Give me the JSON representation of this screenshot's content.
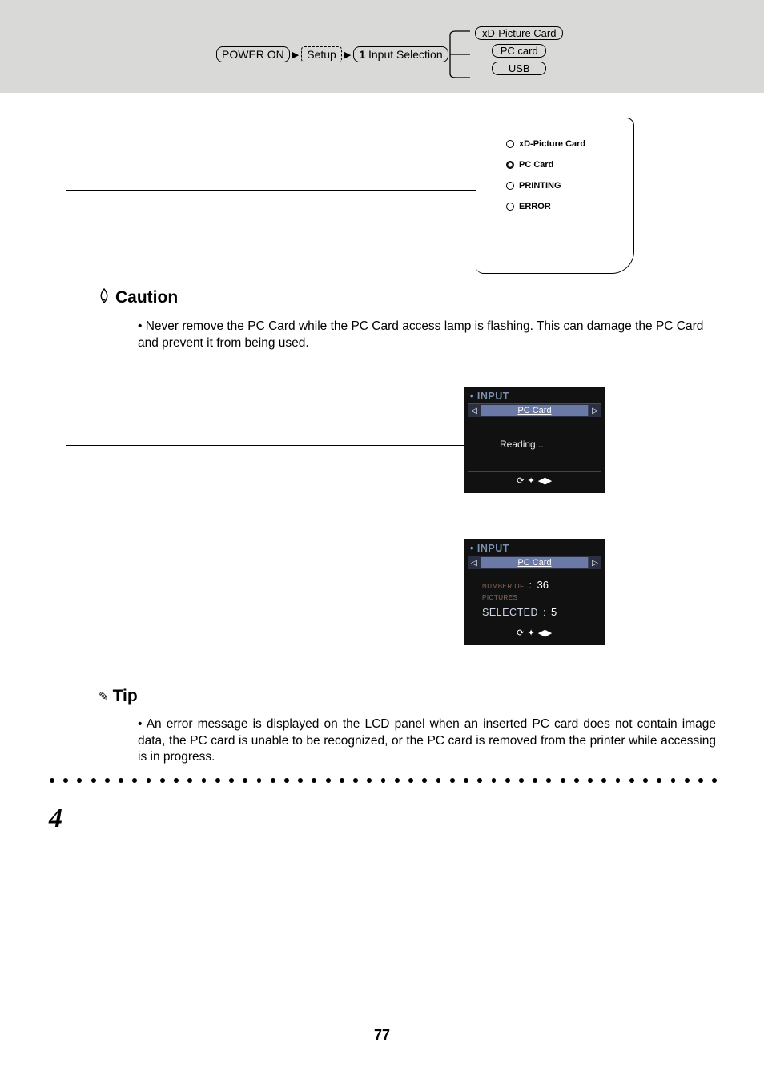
{
  "breadcrumb": {
    "power": "POWER ON",
    "setup": "Setup",
    "input_num": "1",
    "input_label": "Input Selection",
    "options": [
      "xD-Picture Card",
      "PC card",
      "USB"
    ]
  },
  "led_panel": {
    "items": [
      {
        "label": "xD-Picture Card",
        "active": false
      },
      {
        "label": "PC Card",
        "active": true
      },
      {
        "label": "PRINTING",
        "active": false
      },
      {
        "label": "ERROR",
        "active": false
      }
    ]
  },
  "caution": {
    "heading": "Caution",
    "text": "Never remove the PC Card while the PC Card access lamp is flashing.  This can damage the PC Card and prevent it from being used."
  },
  "lcd_a": {
    "title": "INPUT",
    "tab": "PC Card",
    "body": "Reading...",
    "footer_glyphs": "⟳ ✦ ◀▶"
  },
  "lcd_b": {
    "title": "INPUT",
    "tab": "PC Card",
    "rows": [
      {
        "label_line1": "NUMBER OF",
        "label_line2": "PICTURES",
        "sep": ":",
        "value": "36"
      },
      {
        "label_line1": "SELECTED",
        "label_line2": "",
        "sep": ":",
        "value": "5"
      }
    ],
    "footer_glyphs": "⟳ ✦ ◀▶"
  },
  "tip": {
    "heading": "Tip",
    "text": "An error message is displayed on the LCD panel when an inserted PC card does not contain image data, the PC card is unable to be recognized, or the PC card is removed from the printer while accessing is in progress."
  },
  "step_number": "4",
  "page_number": "77"
}
